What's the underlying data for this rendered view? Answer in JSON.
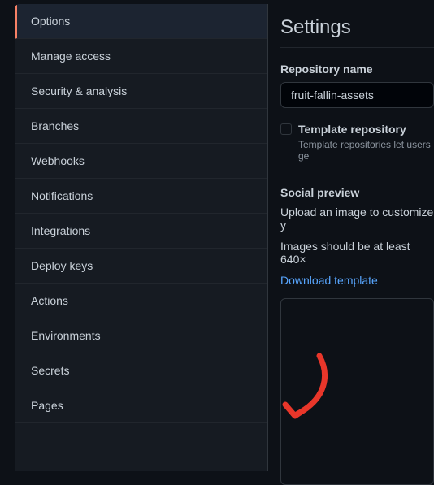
{
  "sidebar": {
    "items": [
      {
        "label": "Options",
        "active": true
      },
      {
        "label": "Manage access"
      },
      {
        "label": "Security & analysis"
      },
      {
        "label": "Branches"
      },
      {
        "label": "Webhooks"
      },
      {
        "label": "Notifications"
      },
      {
        "label": "Integrations"
      },
      {
        "label": "Deploy keys"
      },
      {
        "label": "Actions"
      },
      {
        "label": "Environments"
      },
      {
        "label": "Secrets"
      },
      {
        "label": "Pages"
      }
    ]
  },
  "main": {
    "heading": "Settings",
    "repo_name_label": "Repository name",
    "repo_name_value": "fruit-fallin-assets",
    "template_checkbox_label": "Template repository",
    "template_helper": "Template repositories let users ge",
    "social_preview_label": "Social preview",
    "social_preview_text": "Upload an image to customize y",
    "social_preview_size": "Images should be at least 640×",
    "download_template": "Download template"
  }
}
